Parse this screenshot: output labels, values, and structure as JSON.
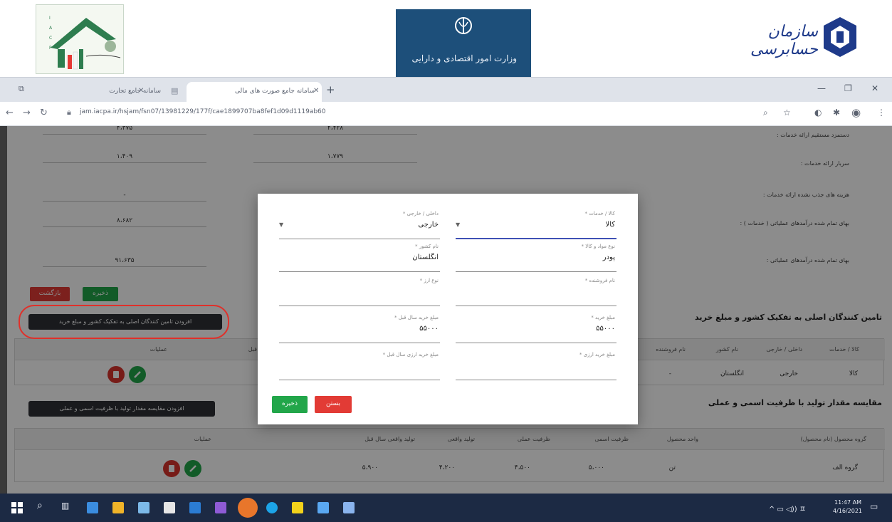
{
  "browser": {
    "tabs": [
      {
        "label": "سامانه جامع تجارت"
      },
      {
        "label": "سامانه جامع صورت های مالی"
      }
    ],
    "url": "jam.iacpa.ir/hsjam/fsn07/13981229/177f/cae1899707ba8fef1d09d1119ab60"
  },
  "logos": {
    "middle_text": "وزارت امور اقتصادی و دارایی",
    "right_text": "سازمان حسابرسی"
  },
  "background_form": {
    "rows": [
      {
        "label": "دستمزد مستقیم ارائه خدمات :",
        "col_a": "۴،۴۲۸",
        "col_b": "۴،۳۷۵"
      },
      {
        "label": "سربار ارائه خدمات :",
        "col_a": "۱،۷۷۹",
        "col_b": "۱،۴۰۹"
      },
      {
        "label": "هزینه های جذب نشده ارائه خدمات :",
        "col_a": "",
        "col_b": "-"
      },
      {
        "label": "بهای تمام شده درآمدهای عملیاتی ( خدمات ) :",
        "col_a": "",
        "col_b": "۸،۶۸۲"
      },
      {
        "label": "بهای تمام شده درآمدهای عملیاتی :",
        "col_a": "",
        "col_b": "۹۱،۶۳۵"
      }
    ],
    "save_label": "ذخیره",
    "back_label": "بازگشت"
  },
  "suppliers_section": {
    "title": "تامین کنندگان اصلی به تفکیک کشور و مبلغ خرید",
    "add_button": "افزودن تامین کنندگان اصلی به تفکیک کشور و مبلغ خرید",
    "headers": [
      "کالا / خدمات",
      "داخلی / خارجی",
      "نام کشور",
      "نام فروشنده",
      "مبلغ خرید سال قبل",
      "عملیات"
    ],
    "row": {
      "item": "کالا",
      "type": "خارجی",
      "country": "انگلستان",
      "seller": "-"
    }
  },
  "production_section": {
    "title": "مقایسه مقدار تولید با ظرفیت اسمی و عملی",
    "add_button": "افزودن مقایسه مقدار تولید با ظرفیت اسمی و عملی",
    "headers": [
      "گروه محصول (نام محصول)",
      "واحد محصول",
      "ظرفیت اسمی",
      "ظرفیت عملی",
      "تولید واقعی",
      "تولید واقعی سال قبل",
      "عملیات"
    ],
    "row": {
      "group": "گروه الف",
      "unit": "تن",
      "nominal": "۵،۰۰۰",
      "practical": "۴،۵۰۰",
      "actual": "۴،۲۰۰",
      "prev_actual": "۵،۹۰۰"
    }
  },
  "dialog": {
    "fields": [
      {
        "label": "کالا / خدمات *",
        "value": "کالا",
        "dropdown": true
      },
      {
        "label": "داخلی / خارجی *",
        "value": "خارجی",
        "dropdown": true
      },
      {
        "label": "نوع مواد و کالا *",
        "value": "پودر"
      },
      {
        "label": "نام کشور *",
        "value": "انگلستان"
      },
      {
        "label": "نام فروشنده *",
        "value": ""
      },
      {
        "label": "نوع ارز *",
        "value": ""
      },
      {
        "label": "مبلغ خرید *",
        "value": "۵۵۰۰۰"
      },
      {
        "label": "مبلغ خرید سال قبل *",
        "value": "۵۵۰۰۰"
      },
      {
        "label": "مبلغ خرید ارزی *",
        "value": ""
      },
      {
        "label": "مبلغ خرید ارزی سال قبل *",
        "value": ""
      }
    ],
    "save_label": "ذخیره",
    "close_label": "بستن"
  },
  "taskbar": {
    "time": "11:47 AM",
    "date": "4/16/2021"
  }
}
